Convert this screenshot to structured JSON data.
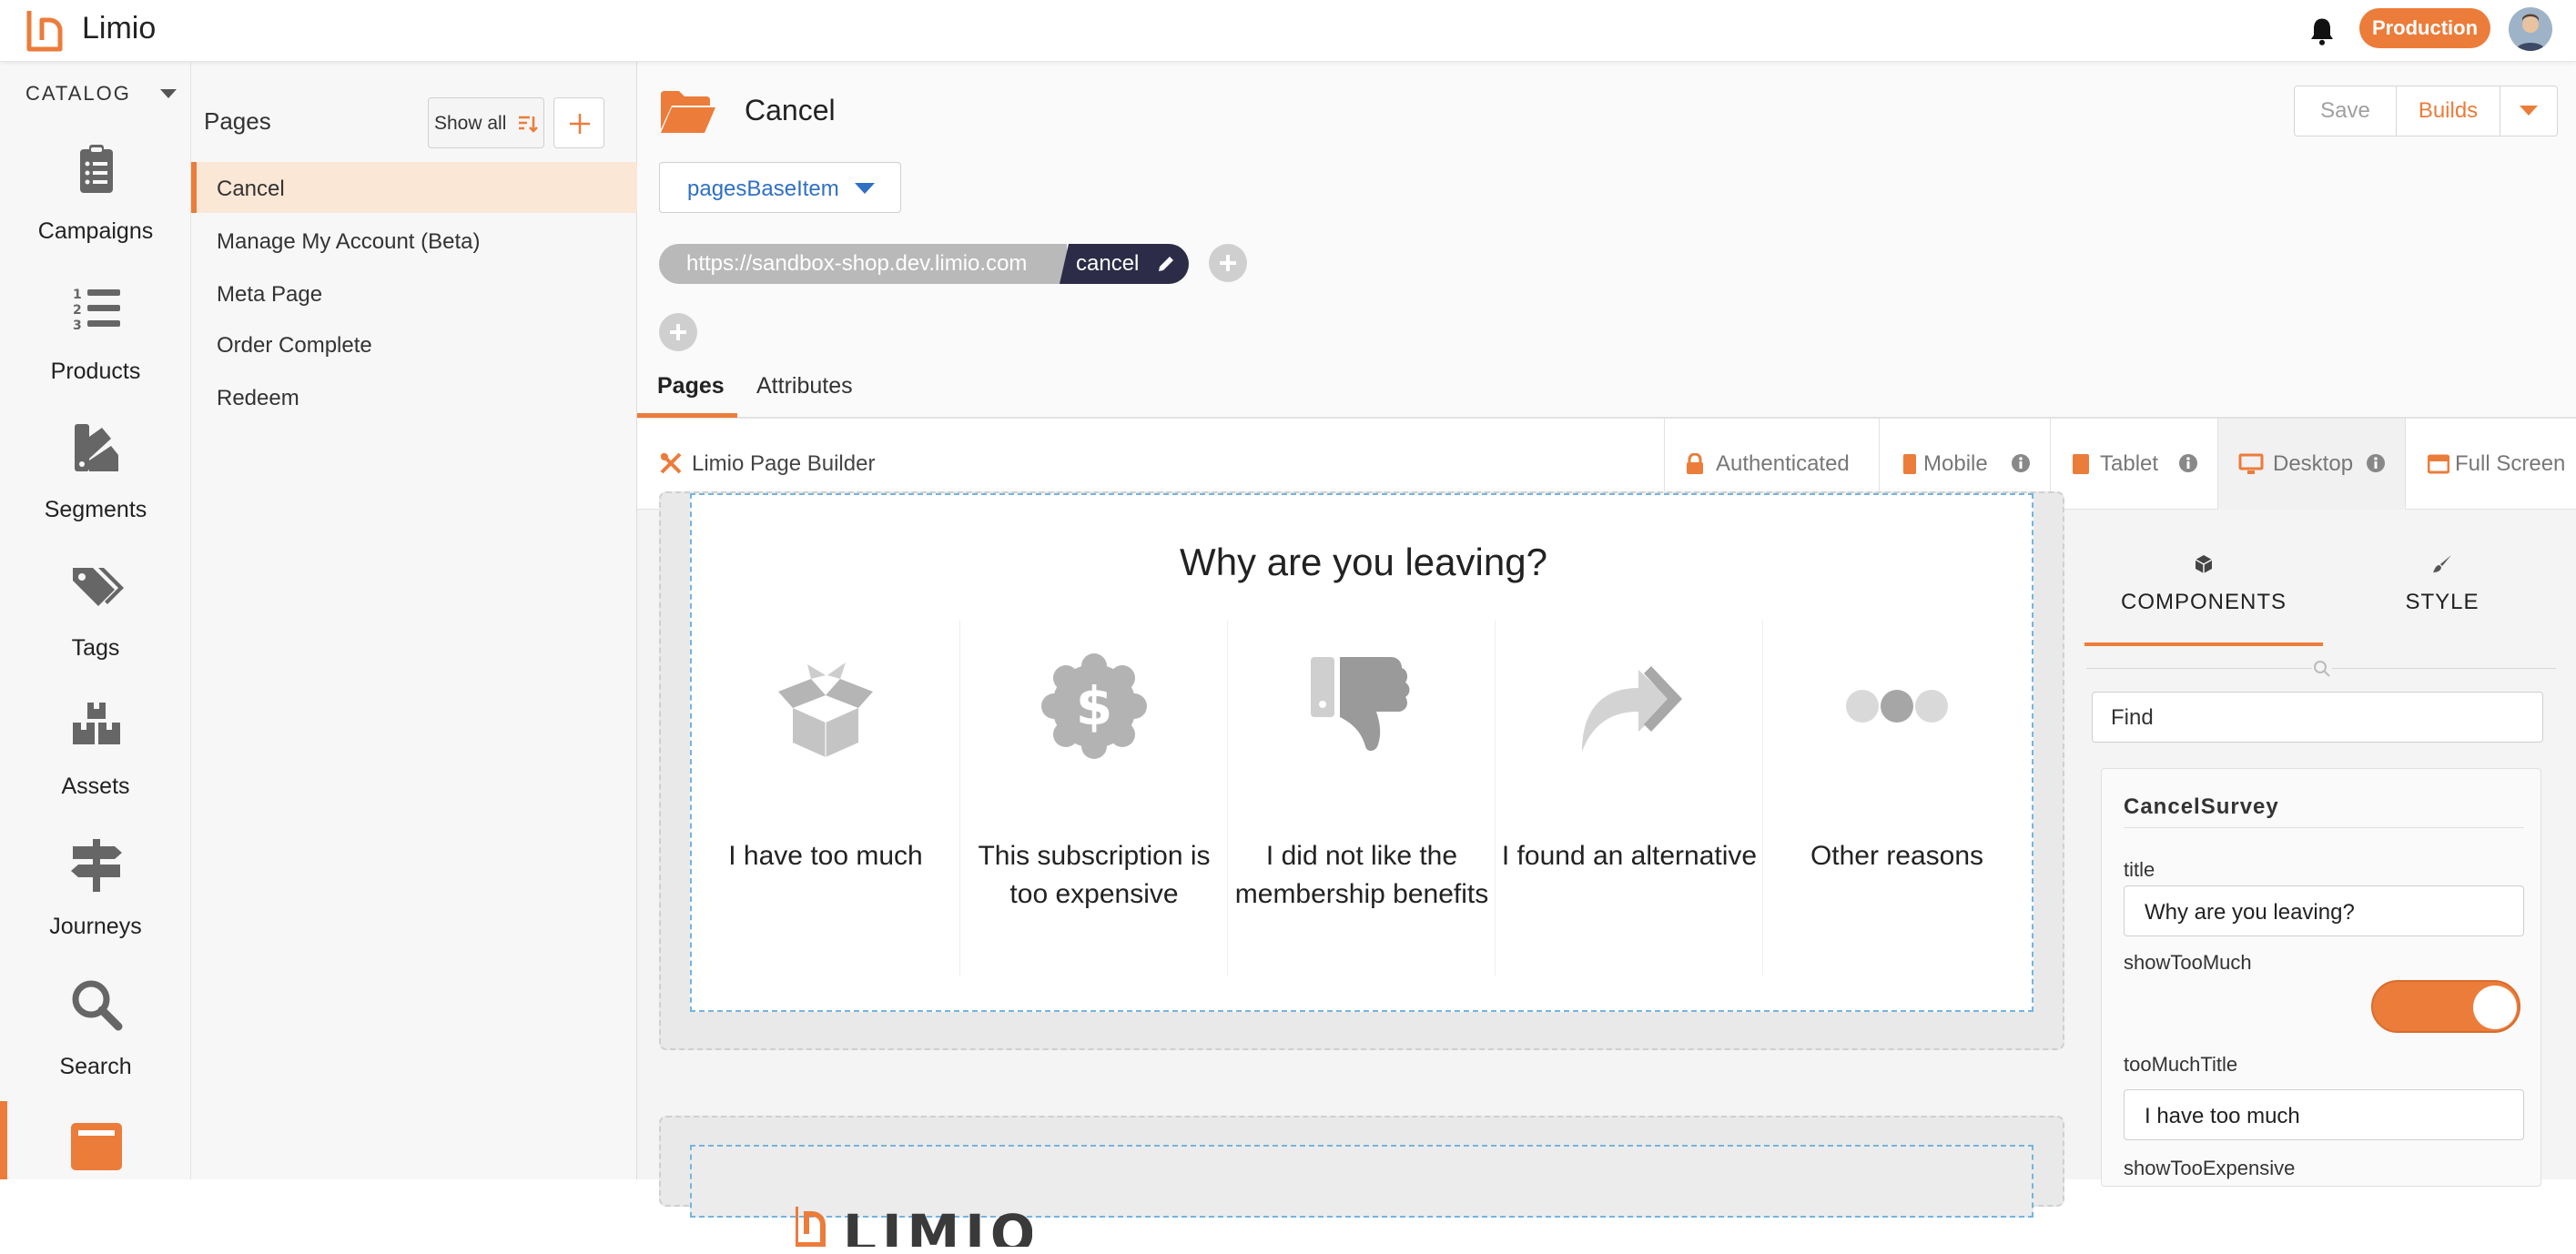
{
  "app": {
    "title": "Limio",
    "environment": "Production",
    "brand_color": "#ec7c3a"
  },
  "sidebar": {
    "section_label": "CATALOG",
    "items": [
      {
        "label": "Campaigns",
        "icon": "clipboard-icon"
      },
      {
        "label": "Products",
        "icon": "numbered-list-icon"
      },
      {
        "label": "Segments",
        "icon": "swatch-icon"
      },
      {
        "label": "Tags",
        "icon": "tags-icon"
      },
      {
        "label": "Assets",
        "icon": "boxes-icon"
      },
      {
        "label": "Journeys",
        "icon": "signpost-icon"
      },
      {
        "label": "Search",
        "icon": "search-icon"
      },
      {
        "label": "",
        "icon": "pages-icon",
        "active": true
      }
    ]
  },
  "pages_panel": {
    "title": "Pages",
    "show_all_label": "Show all",
    "items": [
      "Cancel",
      "Manage My Account (Beta)",
      "Meta Page",
      "Order Complete",
      "Redeem"
    ],
    "active_index": 0
  },
  "header": {
    "page_title": "Cancel",
    "save_label": "Save",
    "builds_label": "Builds",
    "base_item": "pagesBaseItem",
    "url_base": "https://sandbox-shop.dev.limio.com",
    "url_slug": "cancel"
  },
  "tabs": [
    {
      "label": "Pages",
      "active": true
    },
    {
      "label": "Attributes",
      "active": false
    }
  ],
  "builder": {
    "title": "Limio Page Builder",
    "authenticated_label": "Authenticated",
    "mobile_label": "Mobile",
    "tablet_label": "Tablet",
    "desktop_label": "Desktop",
    "desktop_active": true,
    "fullscreen_label": "Full Screen"
  },
  "survey": {
    "title": "Why are you leaving?",
    "options": [
      {
        "label": "I have too much",
        "icon": "open-box-icon"
      },
      {
        "label": "This subscription is too expensive",
        "icon": "dollar-badge-icon"
      },
      {
        "label": "I did not like the membership benefits",
        "icon": "thumbs-down-icon"
      },
      {
        "label": "I found an alternative",
        "icon": "share-arrow-icon"
      },
      {
        "label": "Other reasons",
        "icon": "dots-icon"
      }
    ]
  },
  "brand_logo_text": "LIMIO",
  "component_panel": {
    "components_tab": "COMPONENTS",
    "style_tab": "STYLE",
    "find_value": "Find",
    "component_name": "CancelSurvey",
    "fields": {
      "title_label": "title",
      "title_value": "Why are you leaving?",
      "show_too_much_label": "showTooMuch",
      "show_too_much_on": true,
      "too_much_title_label": "tooMuchTitle",
      "too_much_title_value": "I have too much",
      "show_too_expensive_label": "showTooExpensive"
    }
  }
}
